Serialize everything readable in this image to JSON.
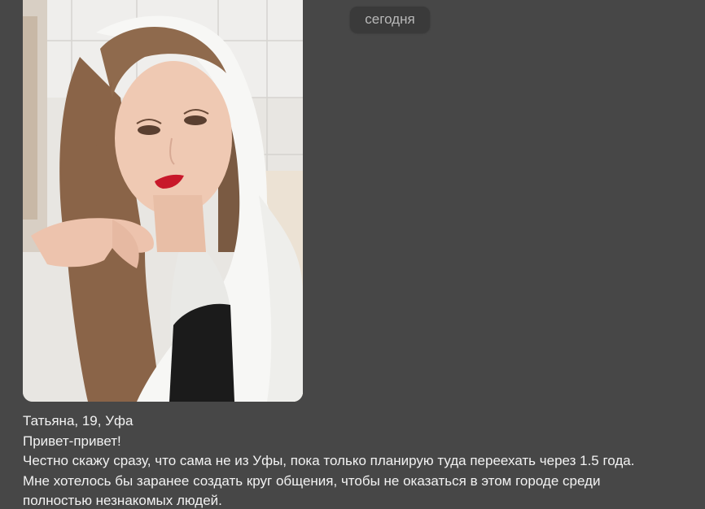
{
  "chat": {
    "date_label": "сегодня",
    "photo": {
      "alt": "Фото: девушка в белом платке, селфи",
      "icon": "photo-attachment"
    },
    "message": {
      "lines": [
        "Татьяна, 19, Уфа",
        "Привет-привет!",
        "Честно скажу сразу, что сама не из Уфы, пока только планирую туда переехать через 1.5 года.",
        "Мне хотелось бы заранее создать круг общения, чтобы не оказаться в этом городе среди",
        "полностью незнакомых людей."
      ]
    }
  },
  "colors": {
    "background": "#474747",
    "date_pill": "#3a3a3a",
    "date_text": "#b8b8b8",
    "message_text": "#f2f2f2"
  }
}
